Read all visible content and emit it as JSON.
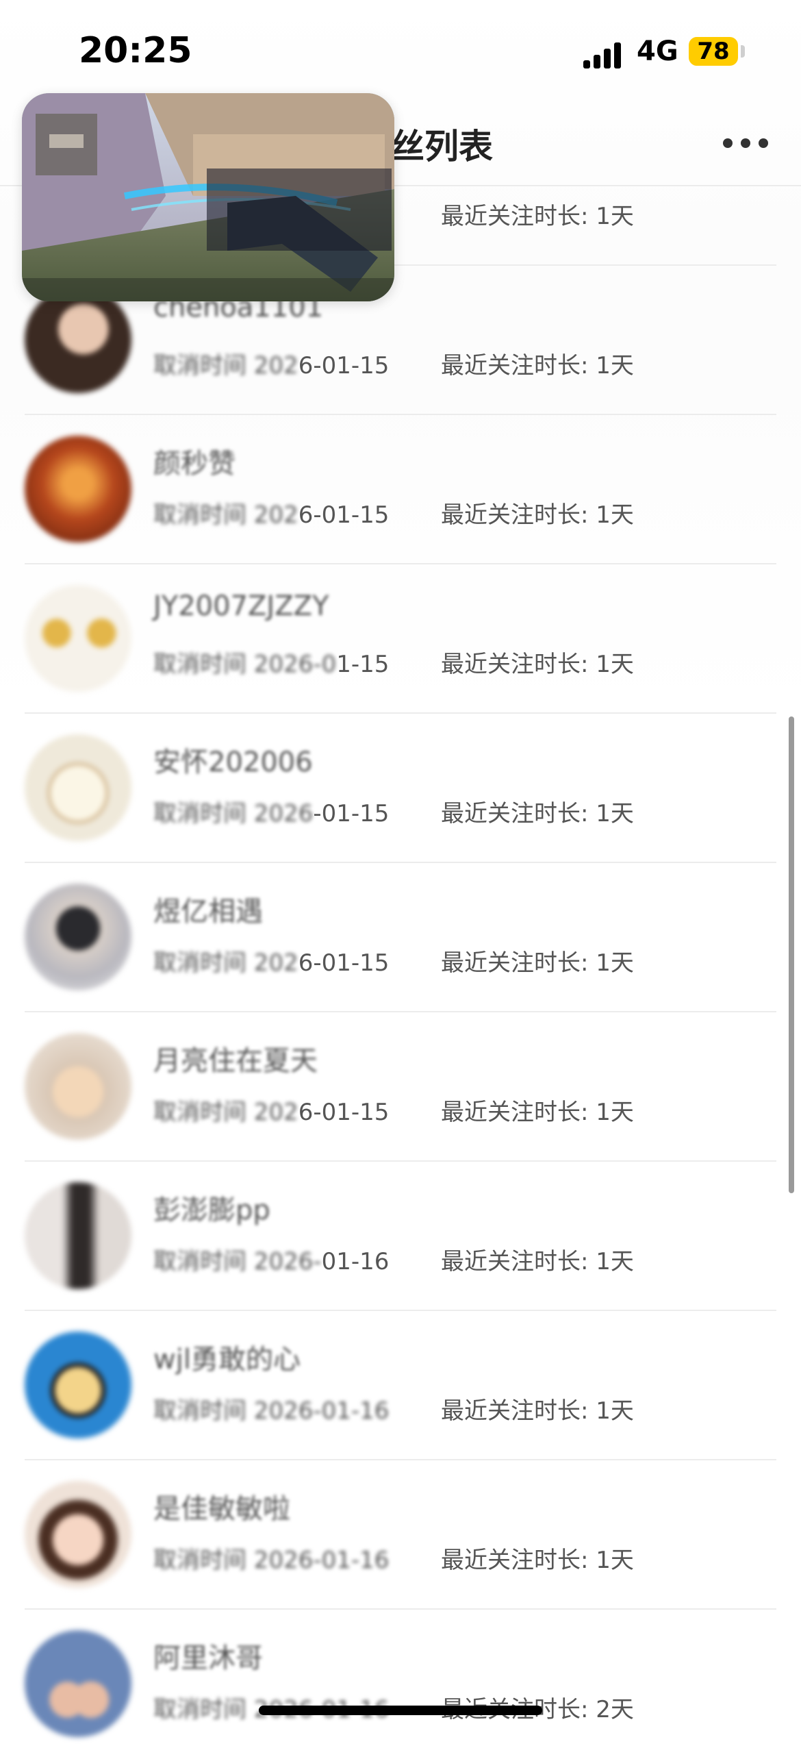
{
  "status_bar": {
    "time": "20:25",
    "network": "4G",
    "battery": "78"
  },
  "nav": {
    "title": "粉丝列表"
  },
  "first_row": {
    "duration": "最近关注时长: 1天"
  },
  "rows": [
    {
      "name": "chenoa1101",
      "cancel_prefix": "取消时间 202",
      "cancel_suffix": "6-01-15",
      "duration": "最近关注时长: 1天",
      "avatar_color": "#3b2a22"
    },
    {
      "name": "颜秒赞",
      "cancel_prefix": "取消时间 202",
      "cancel_suffix": "6-01-15",
      "duration": "最近关注时长: 1天",
      "avatar_color": "#b5461c"
    },
    {
      "name": "JY2007ZJZZY",
      "cancel_prefix": "取消时间 2026-0",
      "cancel_suffix": "1-15",
      "duration": "最近关注时长: 1天",
      "avatar_color": "#f1e6c9"
    },
    {
      "name": "安怀202006",
      "cancel_prefix": "取消时间 2026",
      "cancel_suffix": "-01-15",
      "duration": "最近关注时长: 1天",
      "avatar_color": "#efe9da"
    },
    {
      "name": "煜亿相遇",
      "cancel_prefix": "取消时间 202",
      "cancel_suffix": "6-01-15",
      "duration": "最近关注时长: 1天",
      "avatar_color": "#b9b8bf"
    },
    {
      "name": "月亮住在夏天",
      "cancel_prefix": "取消时间 202",
      "cancel_suffix": "6-01-15",
      "duration": "最近关注时长: 1天",
      "avatar_color": "#d9c7b5"
    },
    {
      "name": "彭澎膨pp",
      "cancel_prefix": "取消时间 2026-",
      "cancel_suffix": "01-16",
      "duration": "最近关注时长: 1天",
      "avatar_color": "#6d6563"
    },
    {
      "name": "wjl勇敢的心",
      "cancel_prefix": "取消时间 2026-01-16",
      "cancel_suffix": "",
      "duration": "最近关注时长: 1天",
      "avatar_color": "#2a86d1"
    },
    {
      "name": "是佳敏敏啦",
      "cancel_prefix": "取消时间 2026-01-16",
      "cancel_suffix": "",
      "duration": "最近关注时长: 1天",
      "avatar_color": "#d6a58a"
    },
    {
      "name": "阿里沐哥",
      "cancel_prefix": "取消时间 2026-01-16",
      "cancel_suffix": "",
      "duration": "最近关注时长: 2天",
      "avatar_color": "#6a87b8"
    }
  ]
}
